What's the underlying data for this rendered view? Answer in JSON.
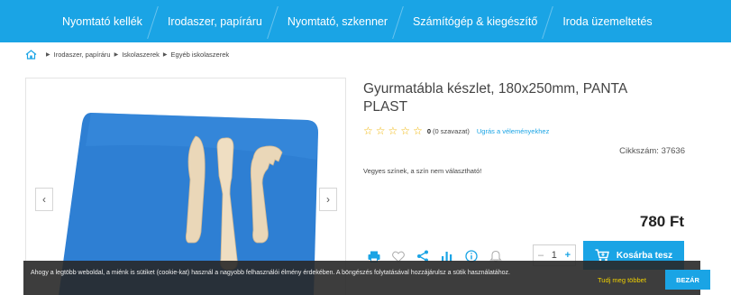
{
  "nav": {
    "items": [
      {
        "label": "Nyomtató kellék"
      },
      {
        "label": "Irodaszer, papíráru"
      },
      {
        "label": "Nyomtató, szkenner"
      },
      {
        "label": "Számítógép & kiegészítő"
      },
      {
        "label": "Iroda üzemeltetés"
      }
    ]
  },
  "breadcrumb": {
    "home_icon": "home-icon",
    "items": [
      "Irodaszer, papíráru",
      "Iskolaszerek",
      "Egyéb iskolaszerek"
    ]
  },
  "gallery": {
    "prev_label": "‹",
    "next_label": "›"
  },
  "product": {
    "title": "Gyurmatábla készlet, 180x250mm, PANTA PLAST",
    "rating": {
      "stars": 0,
      "max_stars": 5,
      "count_value": "0",
      "count_text": "(0 szavazat)",
      "review_link": "Ugrás a véleményekhez"
    },
    "sku_label": "Cikkszám:",
    "sku_value": "37636",
    "description": "Vegyes színek, a szín nem választható!",
    "price": "780 Ft",
    "quantity": "1",
    "minus": "–",
    "plus": "+",
    "cart_label": "Kosárba tesz"
  },
  "colors": {
    "accent": "#1aa4e5",
    "star": "#f0b400",
    "mat": "#2e7fd3"
  },
  "cookie": {
    "text": "Ahogy a legtöbb weboldal, a miénk is sütiket (cookie-kat) használ a nagyobb felhasználói élmény érdekében. A böngészés folytatásával hozzájárulsz a sütik használatához.",
    "more": "Tudj meg többet",
    "close": "BEZÁR"
  }
}
